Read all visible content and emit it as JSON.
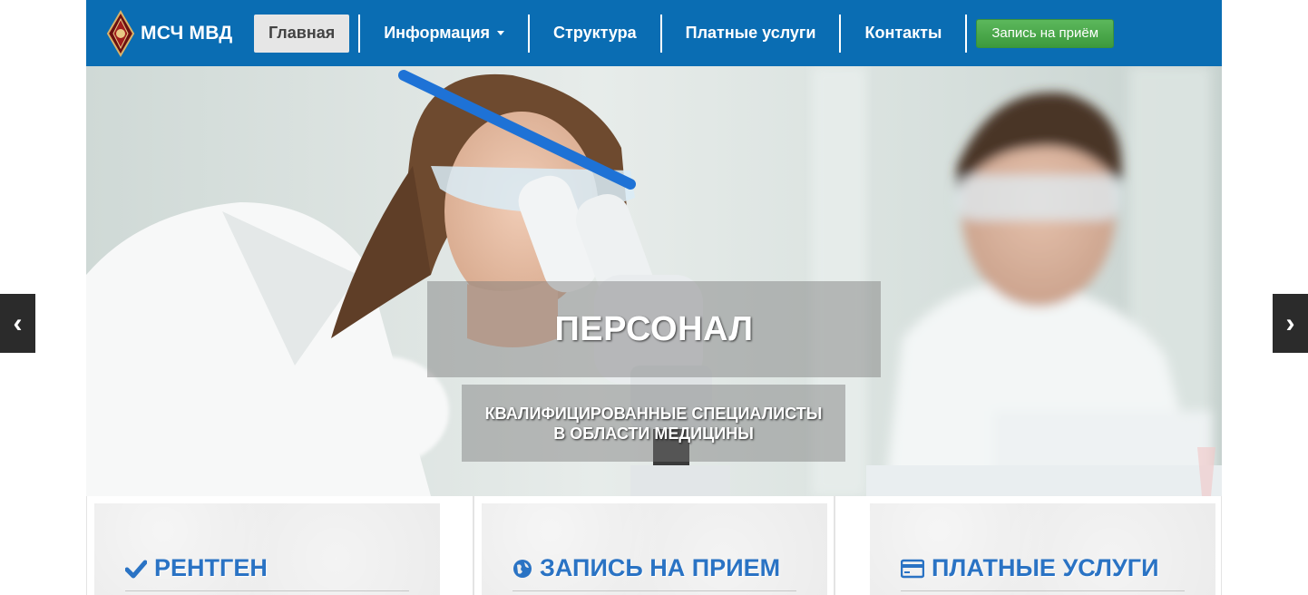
{
  "brand": {
    "name": "МСЧ МВД",
    "logo_icon": "police-shield-emblem-icon"
  },
  "nav": {
    "items": [
      {
        "label": "Главная",
        "active": true
      },
      {
        "label": "Информация",
        "has_dropdown": true
      },
      {
        "label": "Структура"
      },
      {
        "label": "Платные услуги"
      },
      {
        "label": "Контакты"
      }
    ],
    "cta_label": "Запись на приём"
  },
  "slider": {
    "title": "ПЕРСОНАЛ",
    "subtitle_line1": "КВАЛИФИЦИРОВАННЫЕ СПЕЦИАЛИСТЫ",
    "subtitle_line2": "В ОБЛАСТИ МЕДИЦИНЫ",
    "prev_glyph": "‹",
    "next_glyph": "›"
  },
  "cards": [
    {
      "title": "РЕНТГЕН",
      "icon": "checkmark-icon"
    },
    {
      "title": "ЗАПИСЬ НА ПРИЕМ",
      "icon": "globe-icon"
    },
    {
      "title": "ПЛАТНЫЕ УСЛУГИ",
      "icon": "credit-card-icon"
    }
  ],
  "colors": {
    "navbar": "#0a6db3",
    "cta": "#4cae4c",
    "card_title": "#2a73c4"
  }
}
